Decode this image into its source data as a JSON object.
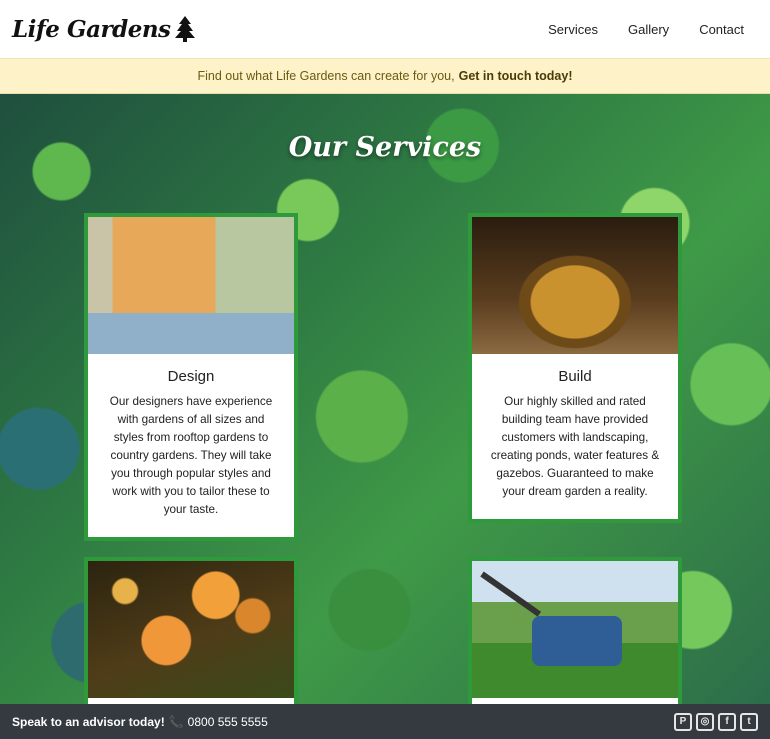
{
  "header": {
    "logo_text": "Life Gardens",
    "nav": [
      "Services",
      "Gallery",
      "Contact"
    ]
  },
  "banner": {
    "text": "Find out what Life Gardens can create for you,",
    "cta": "Get in touch today!"
  },
  "hero": {
    "title": "Our Services"
  },
  "cards": [
    {
      "title": "Design",
      "text": "Our designers have experience with gardens of all sizes and styles from rooftop gardens to country gardens. They will take you through popular styles and work with you to tailor these to your taste.",
      "image_icon": "shed-photo"
    },
    {
      "title": "Build",
      "text": "Our highly skilled and rated building team have provided customers with landscaping, creating ponds, water features & gazebos. Guaranteed to make your dream garden a reality.",
      "image_icon": "fountain-photo"
    },
    {
      "title": "",
      "text": "",
      "image_icon": "flowers-butterfly-photo"
    },
    {
      "title": "",
      "text": "",
      "image_icon": "lawnmower-photo"
    }
  ],
  "footer": {
    "speak": "Speak to an advisor today!",
    "phone": "0800 555 5555",
    "socials": [
      "pinterest",
      "instagram",
      "facebook",
      "twitter"
    ]
  },
  "colors": {
    "card_border": "#2f9a3c",
    "banner_bg": "#fdf2c8",
    "footer_bg": "#343a40"
  }
}
